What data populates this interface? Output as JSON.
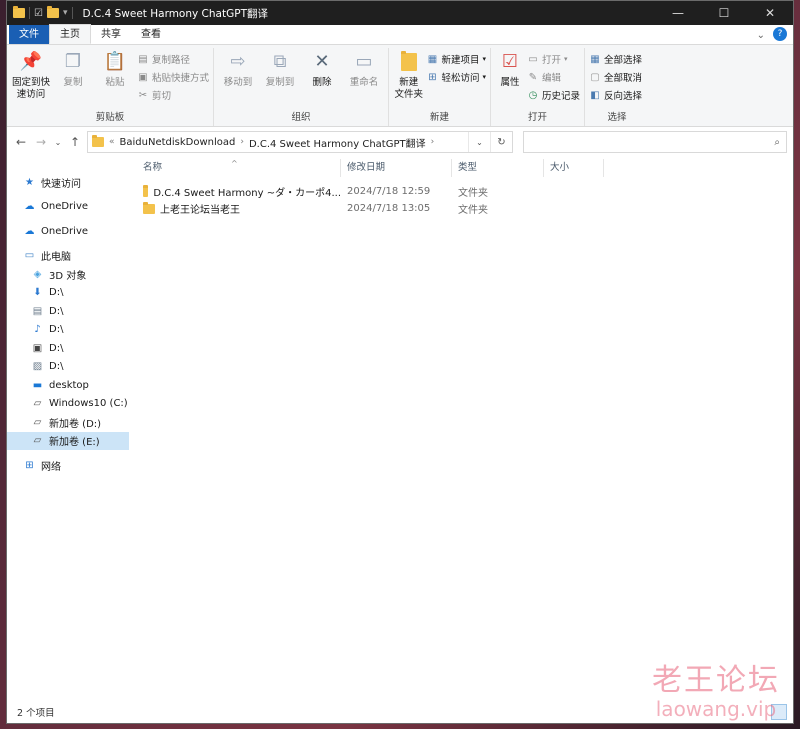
{
  "window": {
    "title": "D.C.4 Sweet Harmony ChatGPT翻译",
    "controls": {
      "minimize": "—",
      "maximize": "☐",
      "close": "✕"
    }
  },
  "ribbon_tabs": [
    "文件",
    "主页",
    "共享",
    "查看"
  ],
  "ribbon": {
    "clipboard": {
      "name": "剪贴板",
      "pin": "固定到快\n速访问",
      "copy": "复制",
      "paste": "粘贴",
      "copy_path": "复制路径",
      "paste_shortcut": "粘贴快捷方式",
      "cut": "剪切"
    },
    "organize": {
      "name": "组织",
      "move_to": "移动到",
      "copy_to": "复制到",
      "delete": "删除",
      "rename": "重命名"
    },
    "new": {
      "name": "新建",
      "new_folder": "新建\n文件夹",
      "new_item": "新建项目",
      "easy_access": "轻松访问"
    },
    "open": {
      "name": "打开",
      "properties": "属性",
      "open": "打开",
      "edit": "编辑",
      "history": "历史记录"
    },
    "select": {
      "name": "选择",
      "select_all": "全部选择",
      "select_none": "全部取消",
      "invert": "反向选择"
    }
  },
  "address": {
    "prefix": "«",
    "crumbs": [
      "BaiduNetdiskDownload",
      "D.C.4 Sweet Harmony ChatGPT翻译"
    ],
    "search_placeholder": ""
  },
  "nav_pane": [
    {
      "label": "快速访问",
      "icon": "star-icon"
    },
    {
      "label": "OneDrive",
      "icon": "cloud-icon"
    },
    {
      "label": "OneDrive",
      "icon": "cloud-icon"
    },
    {
      "label": "此电脑",
      "icon": "computer-icon"
    },
    {
      "label": "3D 对象",
      "icon": "cube-icon"
    },
    {
      "label": "D:\\",
      "icon": "download-icon"
    },
    {
      "label": "D:\\",
      "icon": "document-icon"
    },
    {
      "label": "D:\\",
      "icon": "music-icon"
    },
    {
      "label": "D:\\",
      "icon": "video-icon"
    },
    {
      "label": "D:\\",
      "icon": "picture-icon"
    },
    {
      "label": "desktop",
      "icon": "desktop-icon"
    },
    {
      "label": "Windows10 (C:)",
      "icon": "drive-icon"
    },
    {
      "label": "新加卷 (D:)",
      "icon": "drive-icon"
    },
    {
      "label": "新加卷 (E:)",
      "icon": "drive-icon"
    },
    {
      "label": "网络",
      "icon": "network-icon"
    }
  ],
  "columns": {
    "name": "名称",
    "modified": "修改日期",
    "type": "类型",
    "size": "大小"
  },
  "files": [
    {
      "name": "D.C.4 Sweet Harmony ~ダ・カーポ4...",
      "modified": "2024/7/18 12:59",
      "type": "文件夹",
      "size": ""
    },
    {
      "name": "上老王论坛当老王",
      "modified": "2024/7/18 13:05",
      "type": "文件夹",
      "size": ""
    }
  ],
  "status": {
    "count": "2 个项目"
  },
  "watermark": {
    "cn": "老王论坛",
    "en": "laowang.vip"
  },
  "colors": {
    "accent": "#1a5fb4",
    "folder": "#f3c24b",
    "selection": "#cce4f7",
    "watermark": "#e86078"
  }
}
